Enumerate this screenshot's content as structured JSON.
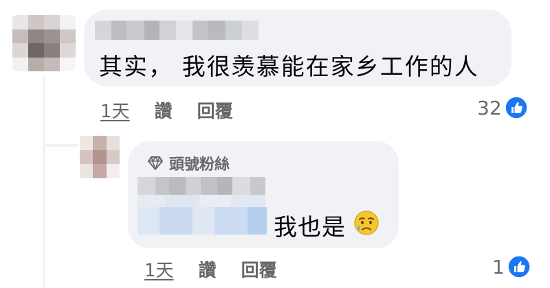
{
  "comment": {
    "text": "其实， 我很羡慕能在家乡工作的人",
    "time": "1天",
    "like_label": "讚",
    "reply_label": "回覆",
    "reaction_count": "32",
    "reaction_icon": "like-icon"
  },
  "reply": {
    "badge": "頭號粉絲",
    "badge_icon": "diamond-icon",
    "text": "我也是",
    "emoji": "crying-face-emoji",
    "time": "1天",
    "like_label": "讚",
    "reply_label": "回覆",
    "reaction_count": "1",
    "reaction_icon": "like-icon"
  },
  "colors": {
    "bubble": "#f0f2f5",
    "secondary_text": "#65676b",
    "like_blue": "#1877f2"
  }
}
